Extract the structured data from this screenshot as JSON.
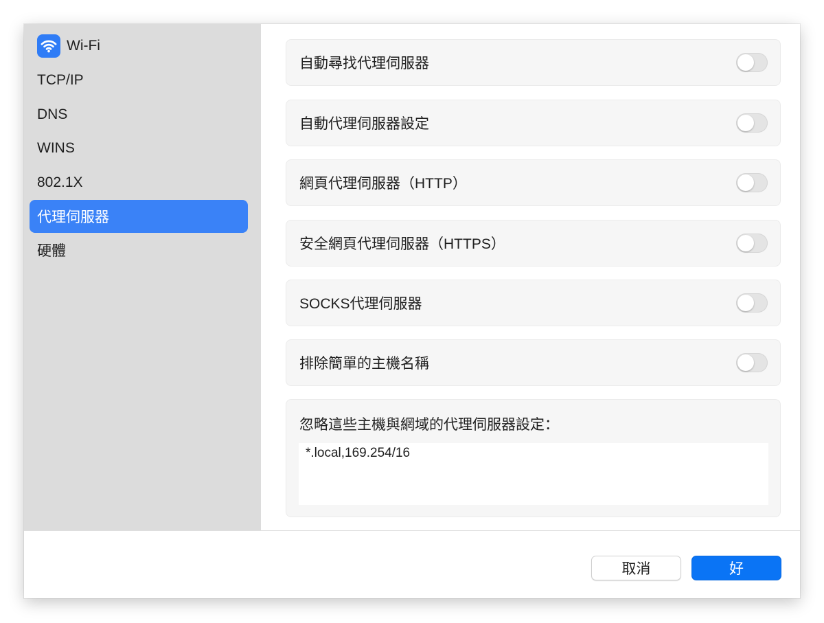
{
  "sidebar": {
    "items": [
      {
        "label": "Wi-Fi",
        "icon": "wifi-icon"
      },
      {
        "label": "TCP/IP"
      },
      {
        "label": "DNS"
      },
      {
        "label": "WINS"
      },
      {
        "label": "802.1X"
      },
      {
        "label": "代理伺服器",
        "selected": true
      },
      {
        "label": "硬體"
      }
    ]
  },
  "main": {
    "proxies": [
      {
        "label": "自動尋找代理伺服器",
        "enabled": false
      },
      {
        "label": "自動代理伺服器設定",
        "enabled": false
      },
      {
        "label": "網頁代理伺服器（HTTP）",
        "enabled": false
      },
      {
        "label": "安全網頁代理伺服器（HTTPS）",
        "enabled": false
      },
      {
        "label": "SOCKS代理伺服器",
        "enabled": false
      },
      {
        "label": "排除簡單的主機名稱",
        "enabled": false
      }
    ],
    "bypass": {
      "label": "忽略這些主機與網域的代理伺服器設定：",
      "value": "*.local,169.254/16"
    }
  },
  "footer": {
    "cancel_label": "取消",
    "ok_label": "好"
  },
  "colors": {
    "accent": "#3a82f7",
    "ok_button": "#0a74f5",
    "sidebar_bg": "#dcdcdc",
    "row_bg": "#f6f6f6"
  }
}
